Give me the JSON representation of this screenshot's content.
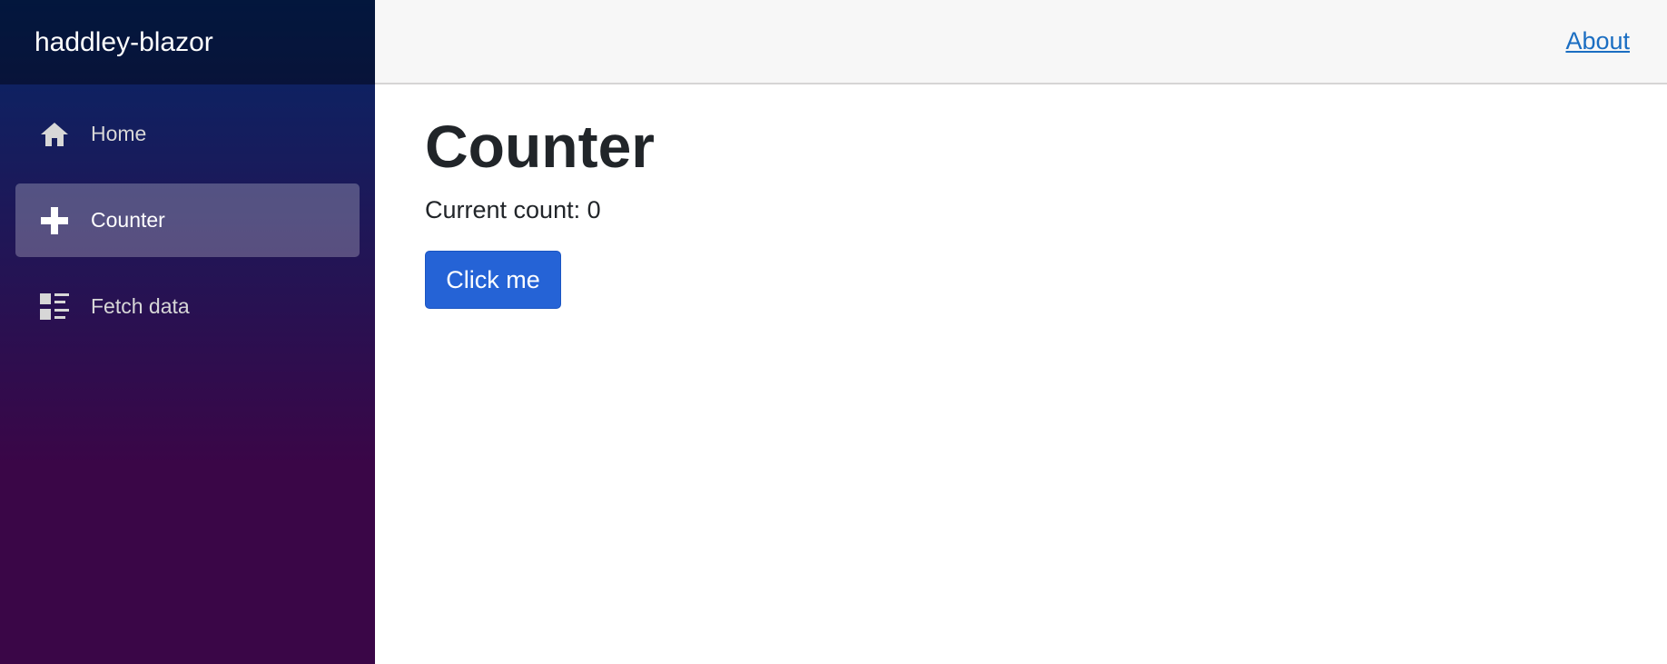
{
  "brand": {
    "title": "haddley-blazor"
  },
  "sidebar": {
    "items": [
      {
        "label": "Home",
        "icon": "home-icon",
        "active": false
      },
      {
        "label": "Counter",
        "icon": "plus-icon",
        "active": true
      },
      {
        "label": "Fetch data",
        "icon": "list-rich-icon",
        "active": false
      }
    ]
  },
  "topbar": {
    "about_label": "About"
  },
  "main": {
    "title": "Counter",
    "count_text": "Current count: 0",
    "button_label": "Click me"
  },
  "colors": {
    "sidebar_gradient_top": "#052767",
    "sidebar_gradient_bottom": "#3a0647",
    "accent_button": "#2563d6",
    "link": "#1b6ec2"
  }
}
